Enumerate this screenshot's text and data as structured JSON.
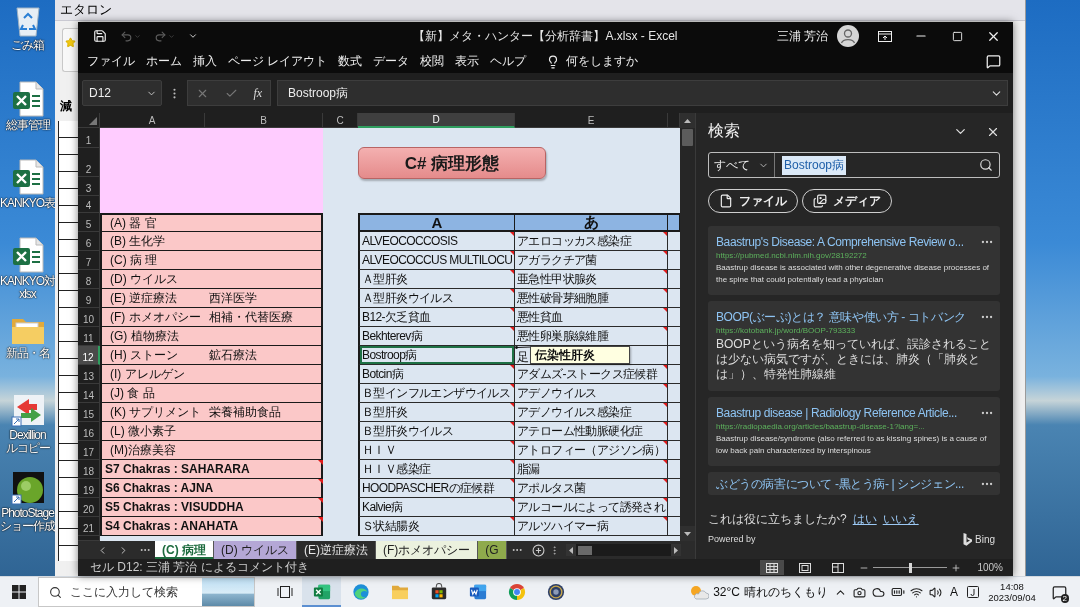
{
  "desktop_icons": [
    {
      "kind": "recycle-bin",
      "lines": [
        "ごみ箱"
      ]
    },
    {
      "kind": "excel-file",
      "lines": [
        "総事管理"
      ]
    },
    {
      "kind": "excel-file",
      "lines": [
        "KANKYO表"
      ]
    },
    {
      "kind": "excel-file",
      "lines": [
        "KANKYO対",
        "xlsx"
      ]
    },
    {
      "kind": "folder",
      "lines": [
        "新品・名"
      ]
    },
    {
      "kind": "shortcut",
      "lines": [
        "Dexillion",
        "ルコピー"
      ]
    },
    {
      "kind": "photo-app",
      "lines": [
        "PhotoStage",
        "ショー作成"
      ]
    }
  ],
  "background_window": {
    "title": "エタロン",
    "label": "減"
  },
  "excel": {
    "title": "【新】メタ・ハンター【分析辞書】A.xlsx - Excel",
    "user": "三浦 芳治",
    "quick_access": [
      {
        "kind": "save",
        "disabled": false
      },
      {
        "kind": "undo",
        "disabled": true
      },
      {
        "kind": "redo",
        "disabled": true
      },
      {
        "kind": "customize",
        "disabled": false
      }
    ],
    "ribbon_tabs": [
      "ファイル",
      "ホーム",
      "挿入",
      "ページ レイアウト",
      "数式",
      "データ",
      "校閲",
      "表示",
      "ヘルプ"
    ],
    "tell_me": "何をしますか",
    "name_box": "D12",
    "function_label": "fx",
    "formula": "Bostroop病",
    "columns": [
      {
        "label": "A",
        "selected": false
      },
      {
        "label": "B",
        "selected": false
      },
      {
        "label": "C",
        "selected": false
      },
      {
        "label": "D",
        "selected": true
      },
      {
        "label": "E",
        "selected": false
      }
    ],
    "rows": [
      {
        "number": "1",
        "selected": false
      },
      {
        "number": "2",
        "selected": false
      },
      {
        "number": "3",
        "selected": false
      },
      {
        "number": "4",
        "selected": false
      },
      {
        "number": "5",
        "selected": false
      },
      {
        "number": "6",
        "selected": false
      },
      {
        "number": "7",
        "selected": false
      },
      {
        "number": "8",
        "selected": false
      },
      {
        "number": "9",
        "selected": false
      },
      {
        "number": "10",
        "selected": false
      },
      {
        "number": "11",
        "selected": false
      },
      {
        "number": "12",
        "selected": true
      },
      {
        "number": "13",
        "selected": false
      },
      {
        "number": "14",
        "selected": false
      },
      {
        "number": "15",
        "selected": false
      },
      {
        "number": "16",
        "selected": false
      },
      {
        "number": "17",
        "selected": false
      },
      {
        "number": "18",
        "selected": false
      },
      {
        "number": "19",
        "selected": false
      },
      {
        "number": "20",
        "selected": false
      },
      {
        "number": "21",
        "selected": false
      }
    ],
    "shape_label": "C# 病理形態",
    "categories": [
      {
        "kind": "category",
        "label": "(A) 器 官",
        "comment": false
      },
      {
        "kind": "category",
        "label": "(B) 生化学",
        "comment": false
      },
      {
        "kind": "category",
        "label": "(C) 病 理",
        "comment": false
      },
      {
        "kind": "category",
        "label": "(D) ウイルス",
        "comment": false
      },
      {
        "kind": "category",
        "label": "(E) 逆症療法",
        "note": "西洋医学",
        "comment": false
      },
      {
        "kind": "category",
        "label": "(F) ホメオパシー",
        "note": "相補・代替医療",
        "comment": false
      },
      {
        "kind": "category",
        "label": "(G) 植物療法",
        "comment": false
      },
      {
        "kind": "category",
        "label": "(H) ストーン",
        "note": "鉱石療法",
        "comment": false
      },
      {
        "kind": "category",
        "label": "(I) アレルゲン",
        "comment": false
      },
      {
        "kind": "category",
        "label": "(J) 食 品",
        "comment": false
      },
      {
        "kind": "category",
        "label": "(K) サプリメント",
        "note": "栄養補助食品",
        "comment": false
      },
      {
        "kind": "category",
        "label": "(L) 微小素子",
        "comment": false
      },
      {
        "kind": "category",
        "label": "(M)治療美容",
        "comment": false
      },
      {
        "kind": "chakra",
        "label": "S7 Chakras : SAHARARA",
        "comment": true
      },
      {
        "kind": "chakra",
        "label": "S6 Chakras : AJNA",
        "comment": true
      },
      {
        "kind": "chakra",
        "label": "S5 Chakras : VISUDDHA",
        "comment": true
      },
      {
        "kind": "chakra",
        "label": "S4 Chakras : ANAHATA",
        "comment": true
      }
    ],
    "table": {
      "headers": [
        "A",
        "あ"
      ],
      "rows": [
        {
          "cells": [
            {
              "text": "ALVEOCOCCOSIS",
              "comment": true,
              "selected": false
            },
            {
              "text": "アエロコッカス感染症",
              "comment": true,
              "selected": false
            }
          ]
        },
        {
          "cells": [
            {
              "text": "ALVEOCOCCUS MULTILOCU",
              "comment": true,
              "selected": false
            },
            {
              "text": "アガラクチア菌",
              "comment": true,
              "selected": false
            }
          ]
        },
        {
          "cells": [
            {
              "text": "Ａ型肝炎",
              "comment": true,
              "selected": false
            },
            {
              "text": "亜急性甲状腺炎",
              "comment": true,
              "selected": false
            }
          ]
        },
        {
          "cells": [
            {
              "text": "Ａ型肝炎ウイルス",
              "comment": true,
              "selected": false
            },
            {
              "text": "悪性破骨芽細胞腫",
              "comment": true,
              "selected": false
            }
          ]
        },
        {
          "cells": [
            {
              "text": "B12-欠乏貧血",
              "comment": true,
              "selected": false
            },
            {
              "text": "悪性貧血",
              "comment": true,
              "selected": false
            }
          ]
        },
        {
          "cells": [
            {
              "text": "Bekhterev病",
              "comment": true,
              "selected": false
            },
            {
              "text": "悪性卵巣腺線維腫",
              "comment": true,
              "selected": false
            }
          ]
        },
        {
          "cells": [
            {
              "text": "Bostroop病",
              "comment": true,
              "selected": true
            },
            {
              "text": "足",
              "comment": false,
              "selected": false
            }
          ]
        },
        {
          "cells": [
            {
              "text": "Botcin病",
              "comment": true,
              "selected": false
            },
            {
              "text": "アダムズ-ストークス症候群",
              "comment": true,
              "selected": false
            }
          ]
        },
        {
          "cells": [
            {
              "text": "Ｂ型インフルエンザウイルス",
              "comment": true,
              "selected": false
            },
            {
              "text": "アデノウイルス",
              "comment": true,
              "selected": false
            }
          ]
        },
        {
          "cells": [
            {
              "text": "Ｂ型肝炎",
              "comment": true,
              "selected": false
            },
            {
              "text": "アデノウイルス感染症",
              "comment": true,
              "selected": false
            }
          ]
        },
        {
          "cells": [
            {
              "text": "Ｂ型肝炎ウイルス",
              "comment": true,
              "selected": false
            },
            {
              "text": "アテローム性動脈硬化症",
              "comment": true,
              "selected": false
            }
          ]
        },
        {
          "cells": [
            {
              "text": "ＨＩＶ",
              "comment": true,
              "selected": false
            },
            {
              "text": "アトロフィー（アジソン病）",
              "comment": true,
              "selected": false
            }
          ]
        },
        {
          "cells": [
            {
              "text": "ＨＩＶ感染症",
              "comment": true,
              "selected": false
            },
            {
              "text": "脂漏",
              "comment": true,
              "selected": false
            }
          ]
        },
        {
          "cells": [
            {
              "text": "HOODPASCHERの症候群",
              "comment": true,
              "selected": false
            },
            {
              "text": "アポルタス菌",
              "comment": true,
              "selected": false
            }
          ]
        },
        {
          "cells": [
            {
              "text": "Kalvie病",
              "comment": true,
              "selected": false
            },
            {
              "text": "アルコールによって誘発され",
              "comment": true,
              "selected": false
            }
          ]
        },
        {
          "cells": [
            {
              "text": "Ｓ状結腸炎",
              "comment": true,
              "selected": false
            },
            {
              "text": "アルツハイマー病",
              "comment": true,
              "selected": false
            }
          ]
        }
      ]
    },
    "comment_popup": "伝染性肝炎",
    "sheet_tabs": [
      {
        "label": "(C) 病理",
        "selected": true
      },
      {
        "label": "(D) ウイルス",
        "selected": false,
        "color": "#b4a7d6"
      },
      {
        "label": "(E)逆症療法",
        "selected": false
      },
      {
        "label": "(F)ホメオパシー",
        "selected": false,
        "color": "#ebf1de"
      },
      {
        "label": "(G",
        "selected": false,
        "color": "#8faa4c"
      }
    ],
    "status": "セル D12: 三浦 芳治 によるコメント付き",
    "view_modes": [
      {
        "kind": "normal",
        "selected": true
      },
      {
        "kind": "page-layout",
        "selected": false
      },
      {
        "kind": "page-break",
        "selected": false
      }
    ],
    "zoom": {
      "level": 0.5,
      "reading": "100%"
    },
    "search_pane": {
      "title": "検索",
      "scope": "すべて",
      "query": {
        "text": "Bostroop病",
        "selected": true
      },
      "filters": [
        {
          "kind": "file",
          "label": "ファイル"
        },
        {
          "kind": "media",
          "label": "メディア"
        }
      ],
      "results": [
        {
          "kind": "english",
          "title": "Baastrup's Disease: A Comprehensive Review o...",
          "url": "https://pubmed.ncbi.nlm.nih.gov/28192272",
          "snippet": "Baastrup disease is associated with other degenerative disease processes of the spine that could potentially lead a physician"
        },
        {
          "kind": "japanese",
          "title": "BOOP(ぶーぷ)とは？ 意味や使い方 - コトバンク",
          "url": "https://kotobank.jp/word/BOOP-793333",
          "snippet": "BOOPという病名を知っていれば、誤診されることは少ない病気ですが、ときには、肺炎（「肺炎とは」）、特発性肺線維"
        },
        {
          "kind": "english",
          "title": "Baastrup disease | Radiology Reference Article...",
          "url": "https://radiopaedia.org/articles/baastrup-disease-1?lang=...",
          "snippet": "Baastrup disease/syndrome (also referred to as kissing spines) is a cause of low back pain characterized by interspinous"
        },
        {
          "kind": "japanese",
          "title": "ぶどうの病害について -黒とう病- | シンジェン..."
        }
      ],
      "feedback": "これは役に立ちましたか?",
      "answers": [
        "はい",
        "いいえ"
      ],
      "powered_by": "Powered by",
      "brand": "Bing"
    }
  },
  "taskbar": {
    "search_placeholder": "ここに入力して検索",
    "apps": [
      {
        "kind": "excel",
        "active": true
      },
      {
        "kind": "edge",
        "active": false
      },
      {
        "kind": "explorer",
        "active": false
      },
      {
        "kind": "store",
        "active": false
      },
      {
        "kind": "word",
        "active": false
      },
      {
        "kind": "chrome",
        "active": false
      },
      {
        "kind": "emblem",
        "active": false
      }
    ],
    "weather": {
      "temperature": "32°C",
      "condition": "晴れのちくもり"
    },
    "ime": "A",
    "time": "14:08",
    "date": "2023/09/04",
    "notification_count": "2"
  }
}
